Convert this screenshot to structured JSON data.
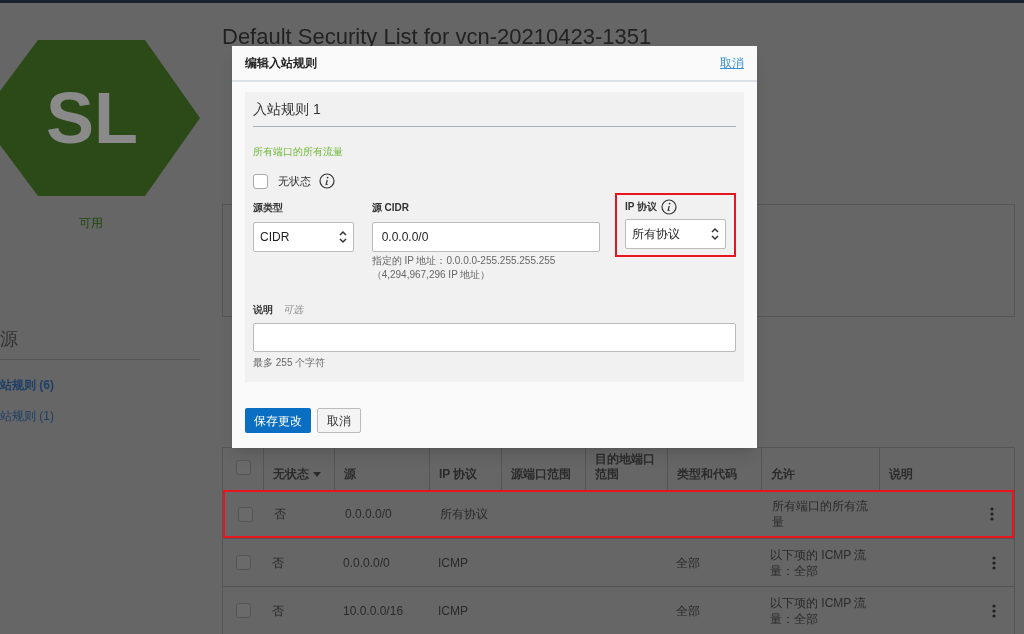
{
  "page": {
    "title": "Default Security List for vcn-20210423-1351",
    "badge": "SL",
    "status": "可用",
    "resources_heading": "源",
    "resource_links": [
      {
        "label": "站规则 (6)",
        "selected": true
      },
      {
        "label": "站规则 (1)",
        "selected": false
      }
    ]
  },
  "dialog": {
    "title": "编辑入站规则",
    "close": "取消",
    "rule_title": "入站规则 1",
    "summary": "所有端口的所有流量",
    "stateless": {
      "label": "无状态",
      "checked": false
    },
    "source_type": {
      "label": "源类型",
      "value": "CIDR"
    },
    "source_cidr": {
      "label": "源 CIDR",
      "value": "0.0.0.0/0",
      "hint": "指定的 IP 地址：0.0.0.0-255.255.255.255",
      "hint2": "（4,294,967,296 IP 地址）"
    },
    "ip_protocol": {
      "label": "IP 协议",
      "value": "所有协议",
      "highlighted": true
    },
    "description": {
      "label": "说明",
      "optional": "可选",
      "hint": "最多 255 个字符"
    },
    "buttons": [
      {
        "label": "保存更改",
        "kind": "primary"
      },
      {
        "label": "取消",
        "kind": "secondary"
      }
    ]
  },
  "table": {
    "header_checked": false,
    "columns": [
      "无状态",
      "源",
      "IP 协议",
      "源端口范围",
      "目的地端口范围",
      "类型和代码",
      "允许",
      "说明"
    ],
    "rows": [
      {
        "checked": false,
        "stateless": "否",
        "source": "0.0.0.0/0",
        "protocol": "所有协议",
        "allows": "所有端口的所有流量",
        "highlighted": true
      },
      {
        "checked": false,
        "stateless": "否",
        "source": "0.0.0.0/0",
        "protocol": "ICMP",
        "type_code": "全部",
        "allows": "以下项的 ICMP 流量：全部",
        "highlighted": false
      },
      {
        "checked": false,
        "stateless": "否",
        "source": "10.0.0.0/16",
        "protocol": "ICMP",
        "type_code": "全部",
        "allows": "以下项的 ICMP 流量：全部",
        "highlighted": false
      }
    ]
  }
}
